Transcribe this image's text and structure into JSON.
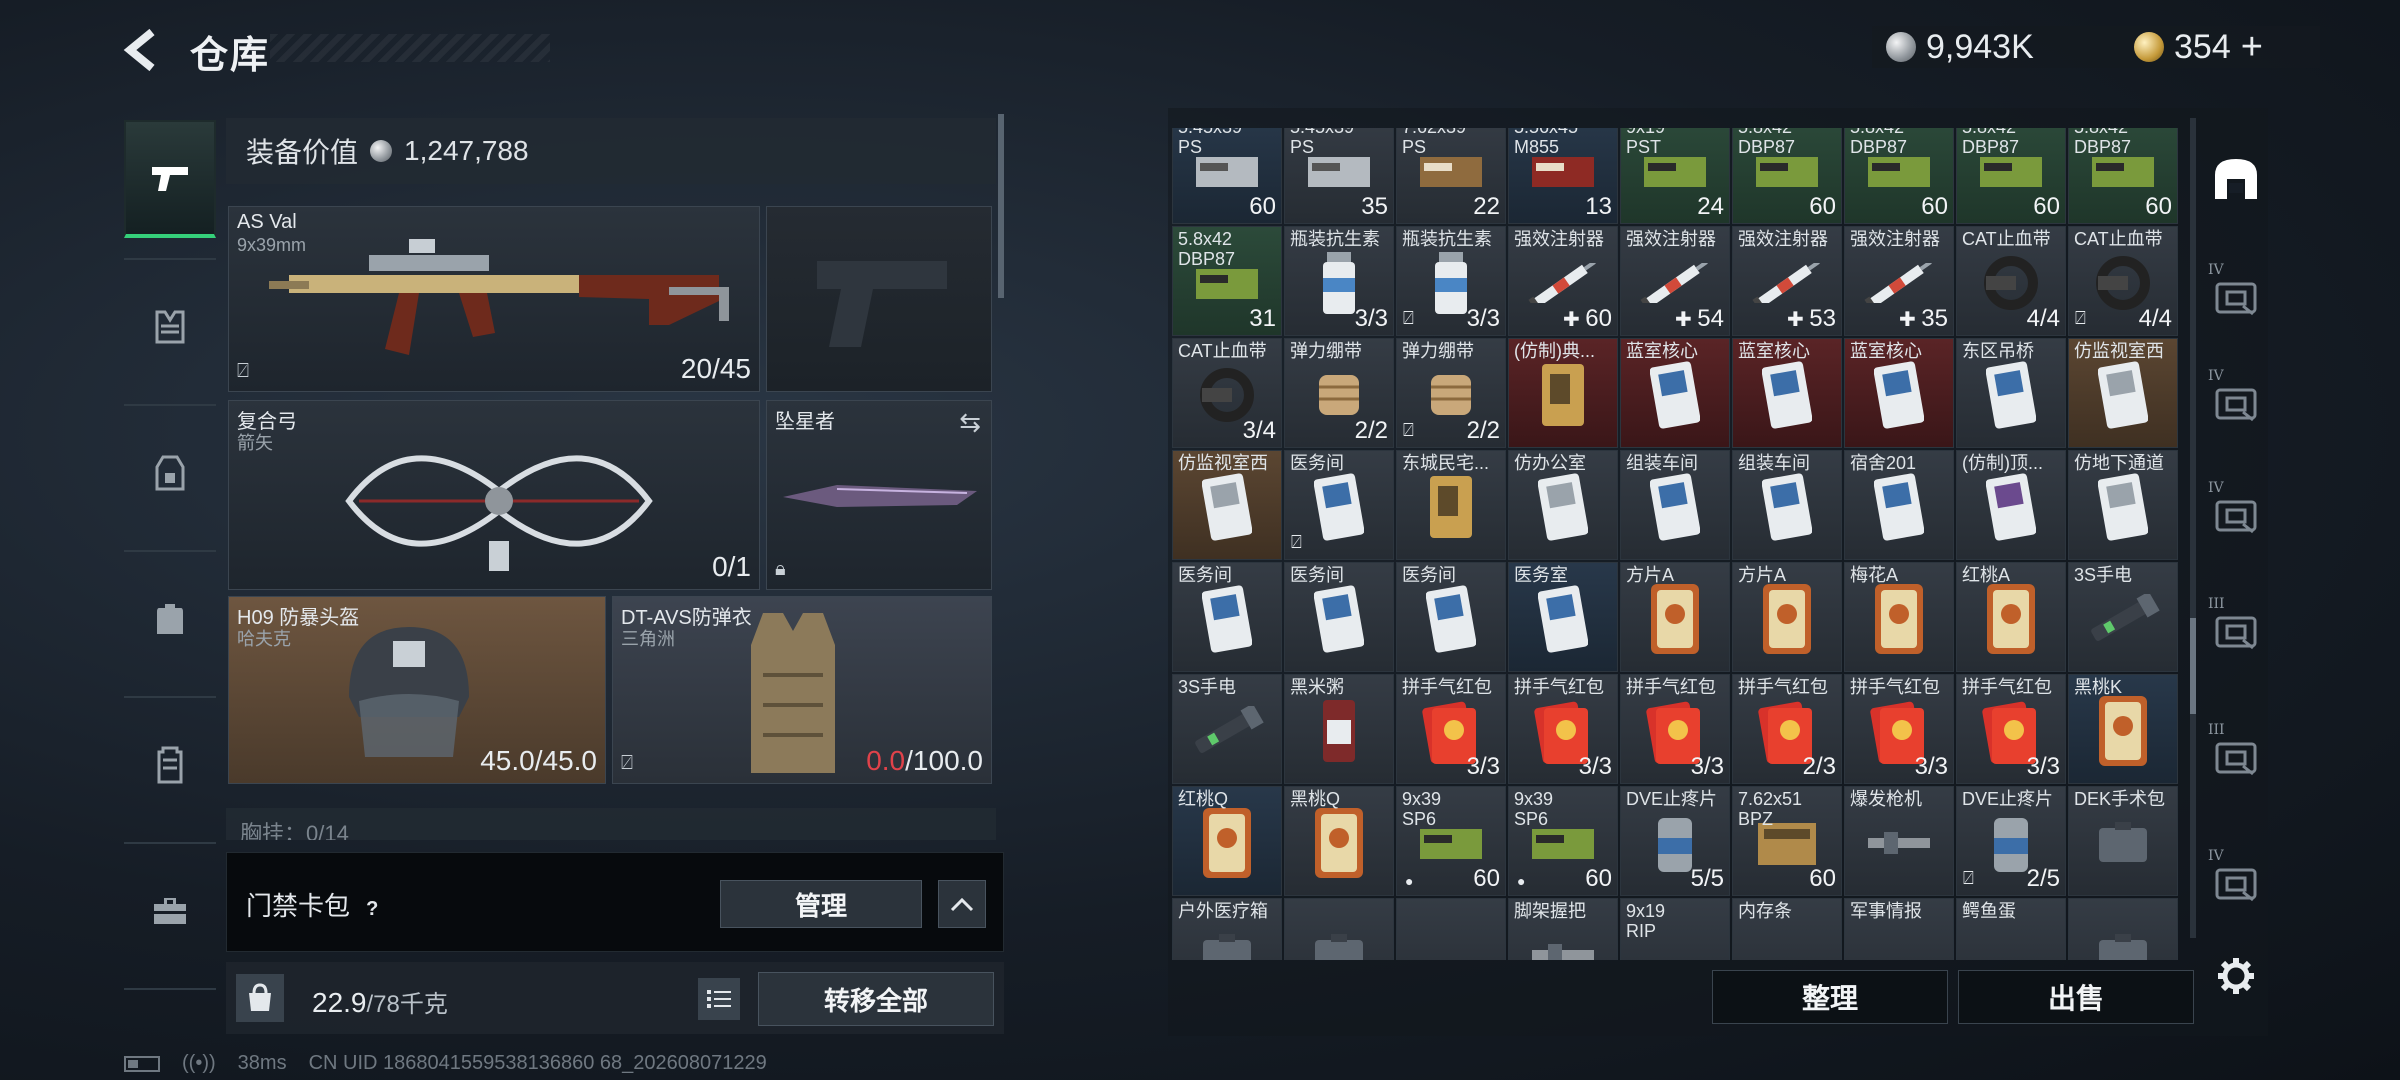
{
  "header": {
    "back_label": "<",
    "title": "仓库",
    "currency_silver": "9,943K",
    "currency_gold": "354",
    "currency_plus": "+"
  },
  "left_nav": {
    "items": [
      {
        "icon": "pistol-icon"
      },
      {
        "icon": "vest-icon"
      },
      {
        "icon": "chest-rig-icon"
      },
      {
        "icon": "backpack-icon"
      },
      {
        "icon": "pouch-icon"
      },
      {
        "icon": "toolbox-icon"
      }
    ]
  },
  "equipment": {
    "value_label": "装备价值",
    "value": "1,247,788",
    "primary": {
      "name": "AS Val",
      "sub": "9x39mm",
      "count": "20/45"
    },
    "bow": {
      "name": "复合弓",
      "sub": "箭矢",
      "count": "0/1"
    },
    "melee": {
      "name": "坠星者"
    },
    "helmet": {
      "name": "H09 防暴头盔",
      "sub": "哈夫克",
      "durability": "45.0/45.0"
    },
    "armor": {
      "name": "DT-AVS防弹衣",
      "sub": "三角洲",
      "durability_current": "0.0",
      "durability_max": "/100.0"
    },
    "chest_partial": "胸挂：0/14",
    "keycard_label": "门禁卡包",
    "help": "?",
    "manage_label": "管理",
    "chevron": "^",
    "weight_current": "22.9",
    "weight_capacity": "/78千克",
    "weight_icon_text": "KG",
    "transfer_label": "转移全部"
  },
  "status": {
    "ping": "38ms",
    "uid": "CN UID 1868041559538136860 68_202608071229"
  },
  "storage": {
    "rows": [
      [
        {
          "name": "5.45x39\nPS",
          "count": "60",
          "color": "c-blue",
          "art": "ammo-gray"
        },
        {
          "name": "5.45x39\nPS",
          "count": "35",
          "color": "c-gray",
          "art": "ammo-gray"
        },
        {
          "name": "7.62x39\nPS",
          "count": "22",
          "color": "c-gray",
          "art": "ammo-brown"
        },
        {
          "name": "5.56x45\nM855",
          "count": "13",
          "color": "c-blue",
          "art": "ammo-red"
        },
        {
          "name": "9x19\nPST",
          "count": "24",
          "color": "c-green",
          "art": "ammo-green"
        },
        {
          "name": "5.8x42\nDBP87",
          "count": "60",
          "color": "c-green",
          "art": "ammo-green"
        },
        {
          "name": "5.8x42\nDBP87",
          "count": "60",
          "color": "c-green",
          "art": "ammo-green"
        },
        {
          "name": "5.8x42\nDBP87",
          "count": "60",
          "color": "c-green",
          "art": "ammo-green"
        },
        {
          "name": "5.8x42\nDBP87",
          "count": "60",
          "color": "c-green",
          "art": "ammo-green"
        }
      ],
      [
        {
          "name": "5.8x42\nDBP87",
          "count": "31",
          "color": "c-green",
          "art": "ammo-green"
        },
        {
          "name": "瓶装抗生素",
          "count": "3/3",
          "color": "c-gray",
          "art": "bottle"
        },
        {
          "name": "瓶装抗生素",
          "count": "3/3",
          "color": "c-gray",
          "art": "bottle",
          "nofilm": true
        },
        {
          "name": "强效注射器",
          "count": "60",
          "plus": true,
          "color": "c-gray",
          "art": "syringe"
        },
        {
          "name": "强效注射器",
          "count": "54",
          "plus": true,
          "color": "c-gray",
          "art": "syringe"
        },
        {
          "name": "强效注射器",
          "count": "53",
          "plus": true,
          "color": "c-gray",
          "art": "syringe"
        },
        {
          "name": "强效注射器",
          "count": "35",
          "plus": true,
          "color": "c-gray",
          "art": "syringe"
        },
        {
          "name": "CAT止血带",
          "count": "4/4",
          "color": "c-gray",
          "art": "tourniquet"
        },
        {
          "name": "CAT止血带",
          "count": "4/4",
          "color": "c-gray",
          "art": "tourniquet",
          "nofilm": true
        }
      ],
      [
        {
          "name": "CAT止血带",
          "count": "3/4",
          "color": "c-gray",
          "art": "tourniquet"
        },
        {
          "name": "弹力绷带",
          "count": "2/2",
          "color": "c-gray",
          "art": "bandage"
        },
        {
          "name": "弹力绷带",
          "count": "2/2",
          "color": "c-gray",
          "art": "bandage",
          "nofilm": true
        },
        {
          "name": "(仿制)典...",
          "count": "",
          "color": "c-red",
          "art": "card-gold"
        },
        {
          "name": "蓝室核心",
          "count": "",
          "color": "c-red",
          "art": "card-blue"
        },
        {
          "name": "蓝室核心",
          "count": "",
          "color": "c-red",
          "art": "card-blue"
        },
        {
          "name": "蓝室核心",
          "count": "",
          "color": "c-red",
          "art": "card-blue"
        },
        {
          "name": "东区吊桥",
          "count": "",
          "color": "c-gray",
          "art": "card-blue"
        },
        {
          "name": "仿监视室西",
          "count": "",
          "color": "c-brown",
          "art": "card-white"
        }
      ],
      [
        {
          "name": "仿监视室西",
          "count": "",
          "color": "c-brown",
          "art": "card-white"
        },
        {
          "name": "医务间",
          "count": "",
          "color": "c-gray",
          "art": "card-blue",
          "nofilm": true
        },
        {
          "name": "东城民宅...",
          "count": "",
          "color": "c-gray",
          "art": "card-gold"
        },
        {
          "name": "仿办公室",
          "count": "",
          "color": "c-gray",
          "art": "card-white"
        },
        {
          "name": "组装车间",
          "count": "",
          "color": "c-gray",
          "art": "card-blue"
        },
        {
          "name": "组装车间",
          "count": "",
          "color": "c-gray",
          "art": "card-blue"
        },
        {
          "name": "宿舍201",
          "count": "",
          "color": "c-gray",
          "art": "card-blue"
        },
        {
          "name": "(仿制)顶...",
          "count": "",
          "color": "c-gray",
          "art": "card-purple"
        },
        {
          "name": "仿地下通道",
          "count": "",
          "color": "c-gray",
          "art": "card-white"
        }
      ],
      [
        {
          "name": "医务间",
          "count": "",
          "color": "c-gray",
          "art": "card-blue"
        },
        {
          "name": "医务间",
          "count": "",
          "color": "c-gray",
          "art": "card-blue"
        },
        {
          "name": "医务间",
          "count": "",
          "color": "c-gray",
          "art": "card-blue"
        },
        {
          "name": "医务室",
          "count": "",
          "color": "c-blue",
          "art": "card-blue"
        },
        {
          "name": "方片A",
          "count": "",
          "color": "c-gray",
          "art": "tarot"
        },
        {
          "name": "方片A",
          "count": "",
          "color": "c-gray",
          "art": "tarot"
        },
        {
          "name": "梅花A",
          "count": "",
          "color": "c-gray",
          "art": "tarot"
        },
        {
          "name": "红桃A",
          "count": "",
          "color": "c-gray",
          "art": "tarot"
        },
        {
          "name": "3S手电",
          "count": "",
          "color": "c-gray",
          "art": "flashlight"
        }
      ],
      [
        {
          "name": "3S手电",
          "count": "",
          "color": "c-gray",
          "art": "flashlight"
        },
        {
          "name": "黑米粥",
          "count": "",
          "color": "c-gray",
          "art": "can"
        },
        {
          "name": "拼手气红包",
          "count": "3/3",
          "color": "c-gray",
          "art": "redpacket"
        },
        {
          "name": "拼手气红包",
          "count": "3/3",
          "color": "c-gray",
          "art": "redpacket"
        },
        {
          "name": "拼手气红包",
          "count": "3/3",
          "color": "c-gray",
          "art": "redpacket"
        },
        {
          "name": "拼手气红包",
          "count": "2/3",
          "color": "c-gray",
          "art": "redpacket"
        },
        {
          "name": "拼手气红包",
          "count": "3/3",
          "color": "c-gray",
          "art": "redpacket"
        },
        {
          "name": "拼手气红包",
          "count": "3/3",
          "color": "c-gray",
          "art": "redpacket"
        },
        {
          "name": "黑桃K",
          "count": "",
          "color": "c-blue",
          "art": "tarot"
        }
      ],
      [
        {
          "name": "红桃Q",
          "count": "",
          "color": "c-blue",
          "art": "tarot"
        },
        {
          "name": "黑桃Q",
          "count": "",
          "color": "c-gray",
          "art": "tarot"
        },
        {
          "name": "9x39\nSP6",
          "count": "60",
          "color": "c-gray",
          "art": "ammo-green",
          "dot": true
        },
        {
          "name": "9x39\nSP6",
          "count": "60",
          "color": "c-gray",
          "art": "ammo-green",
          "dot": true
        },
        {
          "name": "DVE止疼片",
          "count": "5/5",
          "color": "c-gray",
          "art": "pill"
        },
        {
          "name": "7.62x51\nBPZ",
          "count": "60",
          "color": "c-gray",
          "art": "ammo-box"
        },
        {
          "name": "爆发枪机",
          "count": "",
          "color": "c-gray",
          "art": "part"
        },
        {
          "name": "DVE止疼片",
          "count": "2/5",
          "color": "c-gray",
          "art": "pill",
          "nofilm": true
        },
        {
          "name": "DEK手术包",
          "count": "",
          "color": "c-gray",
          "art": "kit"
        }
      ],
      [
        {
          "name": "户外医疗箱",
          "count": "",
          "color": "c-gray",
          "art": "kit"
        },
        {
          "name": "",
          "count": "",
          "color": "c-gray",
          "art": "kit"
        },
        {
          "name": "",
          "count": "",
          "color": "c-gray",
          "art": ""
        },
        {
          "name": "脚架握把",
          "count": "",
          "color": "c-gray",
          "art": "part"
        },
        {
          "name": "9x19\nRIP",
          "count": "",
          "color": "c-gray",
          "art": ""
        },
        {
          "name": "内存条",
          "count": "",
          "color": "c-gray",
          "art": ""
        },
        {
          "name": "军事情报",
          "count": "",
          "color": "c-gray",
          "art": ""
        },
        {
          "name": "鳄鱼蛋",
          "count": "",
          "color": "c-gray",
          "art": ""
        },
        {
          "name": "",
          "count": "",
          "color": "c-gray",
          "art": "kit"
        }
      ]
    ],
    "sort_label": "整理",
    "sell_label": "出售"
  },
  "right_rail": {
    "items": [
      {
        "level": "",
        "icon": "home-shelter-icon"
      },
      {
        "level": "IV",
        "icon": "safe-box-icon"
      },
      {
        "level": "IV",
        "icon": "safe-box-icon"
      },
      {
        "level": "IV",
        "icon": "folder-icon"
      },
      {
        "level": "III",
        "icon": "rack-icon"
      },
      {
        "level": "III",
        "icon": "chest-box-icon"
      },
      {
        "level": "IV",
        "icon": "case-icon"
      }
    ]
  }
}
